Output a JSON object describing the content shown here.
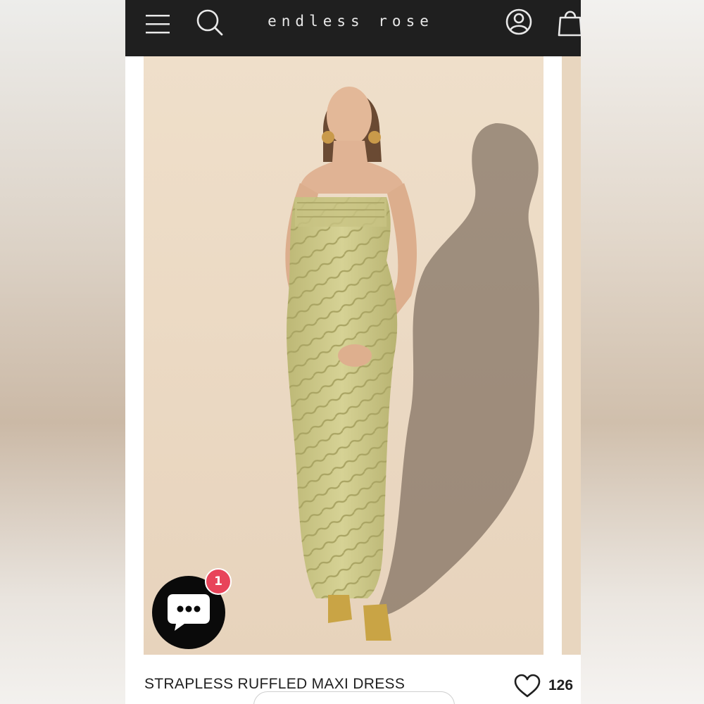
{
  "header": {
    "brand": "endless rose",
    "icons": [
      "menu-icon",
      "search-icon",
      "account-icon",
      "cart-icon"
    ]
  },
  "product": {
    "title": "STRAPLESS RUFFLED MAXI DRESS",
    "likes": "126",
    "image_alt": "Model wearing a pistachio green strapless ruffled maxi dress"
  },
  "chat": {
    "badge_count": "1"
  },
  "colors": {
    "header_bg": "#1f1f1f",
    "badge": "#e8445a",
    "dress": "#cfca8a",
    "backdrop": "#ecdac4"
  }
}
